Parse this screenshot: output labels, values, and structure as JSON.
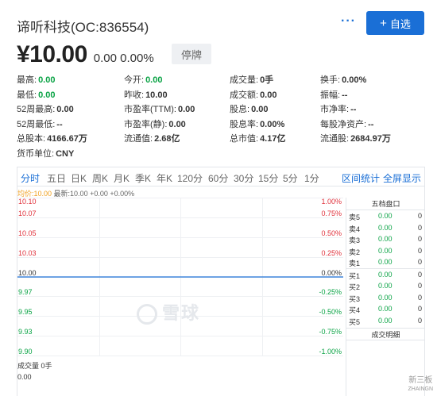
{
  "header": {
    "title": "谛听科技(OC:836554)",
    "more_label": "···",
    "add_button": {
      "icon": "plus-icon",
      "label": "自选"
    }
  },
  "price": {
    "value": "¥10.00",
    "change": "0.00 0.00%",
    "status_badge": "停牌"
  },
  "quote": [
    [
      {
        "label": "最高:",
        "value": "0.00",
        "green": true
      },
      {
        "label": "今开:",
        "value": "0.00",
        "green": true
      },
      {
        "label": "成交量:",
        "value": "0手",
        "green": false
      },
      {
        "label": "换手:",
        "value": "0.00%",
        "green": false
      }
    ],
    [
      {
        "label": "最低:",
        "value": "0.00",
        "green": true
      },
      {
        "label": "昨收:",
        "value": "10.00",
        "green": false
      },
      {
        "label": "成交额:",
        "value": "0.00",
        "green": false
      },
      {
        "label": "振幅:",
        "value": "--",
        "green": false
      }
    ],
    [
      {
        "label": "52周最高:",
        "value": "0.00",
        "green": false
      },
      {
        "label": "市盈率(TTM):",
        "value": "0.00",
        "green": false
      },
      {
        "label": "股息:",
        "value": "0.00",
        "green": false
      },
      {
        "label": "市净率:",
        "value": "--",
        "green": false
      }
    ],
    [
      {
        "label": "52周最低:",
        "value": "--",
        "green": false
      },
      {
        "label": "市盈率(静):",
        "value": "0.00",
        "green": false
      },
      {
        "label": "股息率:",
        "value": "0.00%",
        "green": false
      },
      {
        "label": "每股净资产:",
        "value": "--",
        "green": false
      }
    ],
    [
      {
        "label": "总股本:",
        "value": "4166.67万",
        "green": false
      },
      {
        "label": "流通值:",
        "value": "2.68亿",
        "green": false
      },
      {
        "label": "总市值:",
        "value": "4.17亿",
        "green": false
      },
      {
        "label": "流通股:",
        "value": "2684.97万",
        "green": false
      }
    ],
    [
      {
        "label": "货币单位:",
        "value": "CNY",
        "green": false
      }
    ]
  ],
  "tabs": [
    "分时",
    "五日",
    "日K",
    "周K",
    "月K",
    "季K",
    "年K",
    "120分",
    "60分",
    "30分",
    "15分",
    "5分",
    "1分"
  ],
  "active_tab": "分时",
  "tab_links": [
    "区间统计",
    "全屏显示"
  ],
  "legend": {
    "avg": "均价:10.00",
    "latest": "最新:10.00 +0.00 +0.00%"
  },
  "chart_data": {
    "type": "line",
    "y_left": [
      "10.10",
      "10.07",
      "10.05",
      "10.03",
      "10.00",
      "9.97",
      "9.95",
      "9.93",
      "9.90"
    ],
    "y_right": [
      "1.00%",
      "0.75%",
      "0.50%",
      "0.25%",
      "0.00%",
      "-0.25%",
      "-0.50%",
      "-0.75%",
      "-1.00%"
    ],
    "ylim": [
      9.9,
      10.1
    ],
    "baseline": 10.0,
    "series": [],
    "grid": true
  },
  "volume": {
    "label": "成交量 0手",
    "value": "0.00"
  },
  "watermark": "雪球",
  "order_book": {
    "title": "五档盘口",
    "sell": [
      {
        "label": "卖5",
        "price": "0.00",
        "vol": "0"
      },
      {
        "label": "卖4",
        "price": "0.00",
        "vol": "0"
      },
      {
        "label": "卖3",
        "price": "0.00",
        "vol": "0"
      },
      {
        "label": "卖2",
        "price": "0.00",
        "vol": "0"
      },
      {
        "label": "卖1",
        "price": "0.00",
        "vol": "0"
      }
    ],
    "buy": [
      {
        "label": "买1",
        "price": "0.00",
        "vol": "0"
      },
      {
        "label": "买2",
        "price": "0.00",
        "vol": "0"
      },
      {
        "label": "买3",
        "price": "0.00",
        "vol": "0"
      },
      {
        "label": "买4",
        "price": "0.00",
        "vol": "0"
      },
      {
        "label": "买5",
        "price": "0.00",
        "vol": "0"
      }
    ],
    "deals_title": "成交明细"
  },
  "corner_logo": {
    "text": "新三板",
    "sub": "ZHAINGN"
  },
  "colors": {
    "accent": "#1a6fd6",
    "up": "#e0303a",
    "down": "#0aa345",
    "avg_line": "#f0a020"
  }
}
